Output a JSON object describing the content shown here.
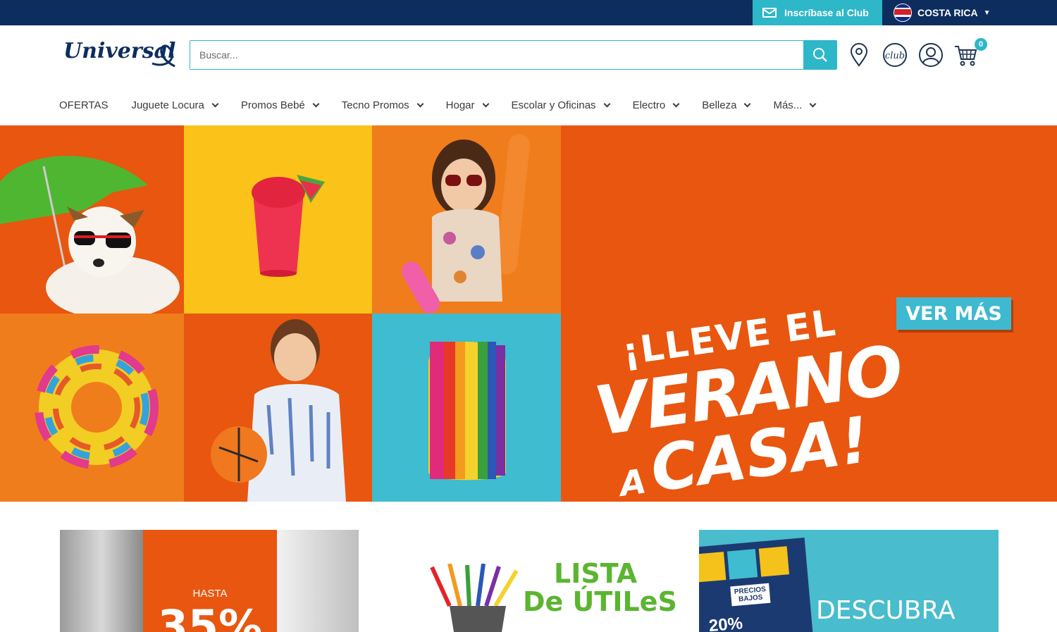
{
  "topbar": {
    "club_signup": "Inscríbase al Club",
    "country": "COSTA RICA"
  },
  "header": {
    "logo_text": "Universal",
    "search_placeholder": "Buscar...",
    "cart_count": "0"
  },
  "nav": {
    "items": [
      {
        "label": "OFERTAS"
      },
      {
        "label": "Juguete Locura"
      },
      {
        "label": "Promos Bebé"
      },
      {
        "label": "Tecno Promos"
      },
      {
        "label": "Hogar"
      },
      {
        "label": "Escolar y Oficinas"
      },
      {
        "label": "Electro"
      },
      {
        "label": "Belleza"
      },
      {
        "label": "Más..."
      }
    ]
  },
  "hero": {
    "line1": "¡LLEVE EL",
    "line2": "VERANO",
    "line3a": "A",
    "line3b": "CASA!",
    "cta": "VER MÁS"
  },
  "cards": {
    "c1_small": "HASTA",
    "c1_big": "35%",
    "c2_line1": "LISTA",
    "c2_line2": "De ÚTILeS",
    "c3_tag": "PRECIOS BAJOS",
    "c3_pct": "20%",
    "c3_text": "DESCUBRA"
  },
  "colors": {
    "navy": "#0c2d5e",
    "teal": "#2eb7c9",
    "orange": "#e9560f",
    "yellow": "#fbc319"
  }
}
